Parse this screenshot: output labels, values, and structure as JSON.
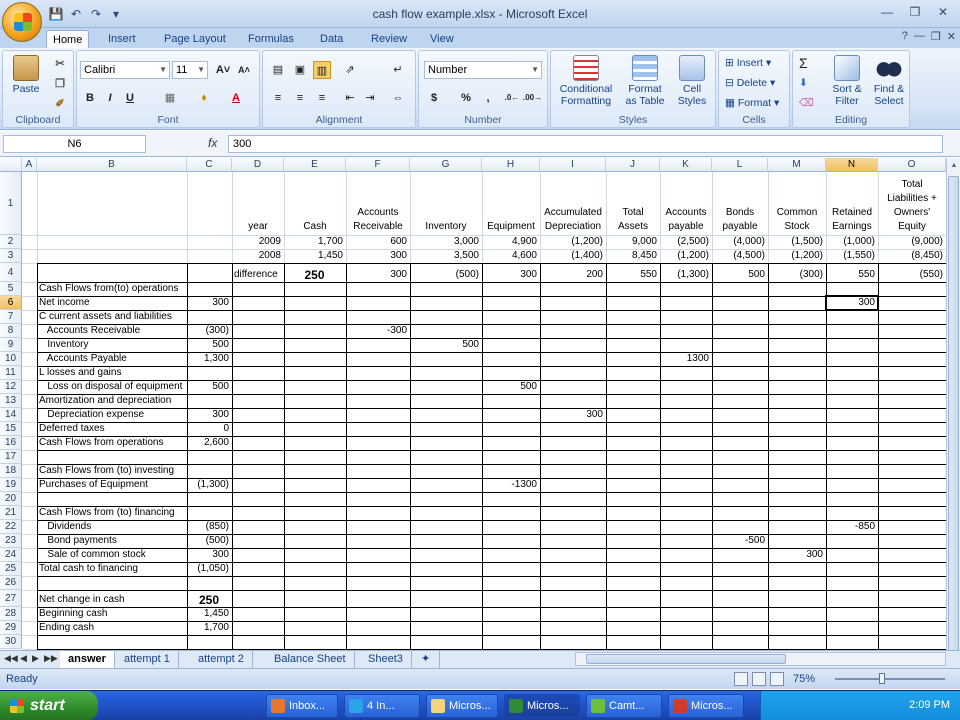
{
  "window": {
    "title": "cash flow example.xlsx - Microsoft Excel"
  },
  "tabs": [
    "Home",
    "Insert",
    "Page Layout",
    "Formulas",
    "Data",
    "Review",
    "View"
  ],
  "ribbon": {
    "clipboard": {
      "label": "Clipboard",
      "paste": "Paste"
    },
    "font": {
      "label": "Font",
      "name": "Calibri",
      "size": "11"
    },
    "alignment": {
      "label": "Alignment"
    },
    "number": {
      "label": "Number",
      "format": "Number",
      "currency": "$",
      "percent": "%",
      "comma": ","
    },
    "styles": {
      "label": "Styles",
      "conditional": "Conditional",
      "conditional2": "Formatting",
      "format_table": "Format",
      "format_table2": "as Table",
      "cell_styles": "Cell",
      "cell_styles2": "Styles"
    },
    "cells": {
      "label": "Cells",
      "insert": "Insert",
      "delete": "Delete",
      "format": "Format"
    },
    "editing": {
      "label": "Editing",
      "sigma": "Σ",
      "sort": "Sort &",
      "sort2": "Filter",
      "find": "Find &",
      "find2": "Select"
    }
  },
  "formula_bar": {
    "name_box": "N6",
    "fx": "fx",
    "value": "300"
  },
  "columns": [
    "A",
    "B",
    "C",
    "D",
    "E",
    "F",
    "G",
    "H",
    "I",
    "J",
    "K",
    "L",
    "M",
    "N",
    "O"
  ],
  "rows": [
    "1",
    "2",
    "3",
    "4",
    "5",
    "6",
    "7",
    "8",
    "9",
    "10",
    "11",
    "12",
    "13",
    "14",
    "15",
    "16",
    "17",
    "18",
    "19",
    "20",
    "21",
    "22",
    "23",
    "24",
    "25",
    "26",
    "27",
    "28",
    "29",
    "30"
  ],
  "header_row": {
    "year": "year",
    "cash": "Cash",
    "ar1": "Accounts",
    "ar2": "Receivable",
    "inventory": "Inventory",
    "equipment": "Equipment",
    "ad1": "Accumulated",
    "ad2": "Depreciation",
    "ta1": "Total",
    "ta2": "Assets",
    "ap1": "Accounts",
    "ap2": "payable",
    "bp1": "Bonds",
    "bp2": "payable",
    "cs1": "Common",
    "cs2": "Stock",
    "re1": "Retained",
    "re2": "Earnings",
    "tl1": "Total",
    "tl2": "Liabilities +",
    "tl3": "Owners'",
    "tl4": "Equity"
  },
  "data_rows": [
    [
      "2009",
      "1,700",
      "600",
      "3,000",
      "4,900",
      "(1,200)",
      "9,000",
      "(2,500)",
      "(4,000)",
      "(1,500)",
      "(1,000)",
      "(9,000)"
    ],
    [
      "2008",
      "1,450",
      "300",
      "3,500",
      "4,600",
      "(1,400)",
      "8,450",
      "(1,200)",
      "(4,500)",
      "(1,200)",
      "(1,550)",
      "(8,450)"
    ],
    [
      "difference",
      "250",
      "300",
      "(500)",
      "300",
      "200",
      "550",
      "(1,300)",
      "500",
      "(300)",
      "550",
      "(550)"
    ]
  ],
  "b_labels": [
    [
      "Cash Flows from(to) operations",
      ""
    ],
    [
      "Net income",
      "300"
    ],
    [
      "C current assets and liabilities",
      ""
    ],
    [
      "   Accounts Receivable",
      "(300)"
    ],
    [
      "   Inventory",
      "500"
    ],
    [
      "   Accounts Payable",
      "1,300"
    ],
    [
      "L losses and gains",
      ""
    ],
    [
      "   Loss on disposal of equipment",
      "500"
    ],
    [
      "Amortization and depreciation",
      ""
    ],
    [
      "   Depreciation expense",
      "300"
    ],
    [
      "Deferred taxes",
      "0"
    ],
    [
      "Cash Flows from operations",
      "2,600"
    ],
    [
      "",
      ""
    ],
    [
      "Cash Flows from (to) investing",
      ""
    ],
    [
      "Purchases of Equipment",
      "(1,300)"
    ],
    [
      "",
      ""
    ],
    [
      "Cash Flows from (to) financing",
      ""
    ],
    [
      "   Dividends",
      "(850)"
    ],
    [
      "   Bond payments",
      "(500)"
    ],
    [
      "   Sale of common stock",
      "300"
    ],
    [
      "Total cash to financing",
      "(1,050)"
    ],
    [
      "",
      ""
    ],
    [
      "Net change in cash",
      "250"
    ],
    [
      "Beginning cash",
      "1,450"
    ],
    [
      "Ending cash",
      "1,700"
    ]
  ],
  "entries": {
    "f8": "-300",
    "g9": "500",
    "k10": "1300",
    "h12": "500",
    "i14": "300",
    "n6": "300",
    "h19": "-1300",
    "n22": "-850",
    "l23": "-500",
    "m24": "300"
  },
  "sheet_tabs": [
    "answer",
    "attempt 1",
    "attempt 2",
    "Balance Sheet",
    "Sheet3"
  ],
  "status": {
    "ready": "Ready",
    "zoom": "75%"
  },
  "taskbar": {
    "start": "start",
    "buttons": [
      "Inbox...",
      "4 In...",
      "Micros...",
      "Micros...",
      "Camt...",
      "Micros..."
    ],
    "clock": "2:09 PM"
  }
}
